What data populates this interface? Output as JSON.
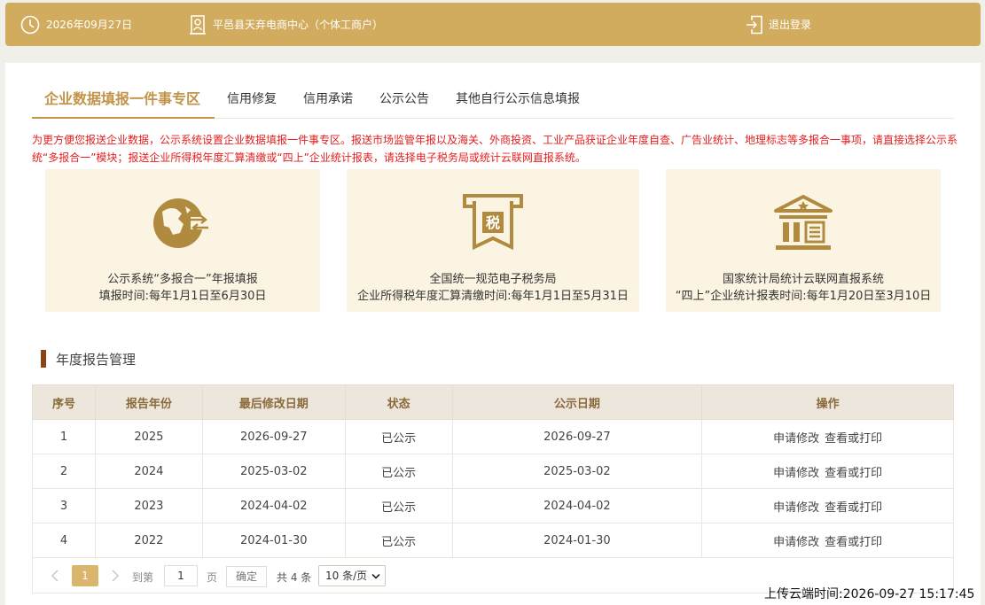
{
  "header": {
    "date": "2026年09月27日",
    "company": "平邑县天弃电商中心（个体工商户）",
    "logout_label": "退出登录"
  },
  "tabs": [
    {
      "label": "企业数据填报一件事专区"
    },
    {
      "label": "信用修复"
    },
    {
      "label": "信用承诺"
    },
    {
      "label": "公示公告"
    },
    {
      "label": "其他自行公示信息填报"
    }
  ],
  "notice": "为更方便您报送企业数据，公示系统设置企业数据填报一件事专区。报送市场监管年报以及海关、外商投资、工业产品获证企业年度自查、广告业统计、地理标志等多报合一事项，请直接选择公示系统“多报合一”模块；报送企业所得税年度汇算清缴或“四上”企业统计报表，请选择电子税务局或统计云联网直报系统。",
  "cards": [
    {
      "icon": "annual-report-icon",
      "line1": "公示系统“多报合一”年报填报",
      "line2": "填报时间:每年1月1日至6月30日"
    },
    {
      "icon": "tax-icon",
      "icon_text": "税",
      "line1": "全国统一规范电子税务局",
      "line2": "企业所得税年度汇算清缴时间:每年1月1日至5月31日"
    },
    {
      "icon": "bank-building-icon",
      "line1": "国家统计局统计云联网直报系统",
      "line2": "“四上”企业统计报表时间:每年1月20日至3月10日"
    }
  ],
  "section_title": "年度报告管理",
  "table": {
    "headers": [
      "序号",
      "报告年份",
      "最后修改日期",
      "状态",
      "公示日期",
      "操作"
    ],
    "rows": [
      {
        "no": "1",
        "year": "2025",
        "modified": "2026-09-27",
        "status": "已公示",
        "published": "2026-09-27"
      },
      {
        "no": "2",
        "year": "2024",
        "modified": "2025-03-02",
        "status": "已公示",
        "published": "2025-03-02"
      },
      {
        "no": "3",
        "year": "2023",
        "modified": "2024-04-02",
        "status": "已公示",
        "published": "2024-04-02"
      },
      {
        "no": "4",
        "year": "2022",
        "modified": "2024-01-30",
        "status": "已公示",
        "published": "2024-01-30"
      }
    ],
    "action_modify": "申请修改",
    "action_view": "查看或打印"
  },
  "pager": {
    "current_page": "1",
    "goto_label": "到第",
    "goto_value": "1",
    "page_unit": "页",
    "confirm_label": "确定",
    "total": "共 4 条",
    "page_size": "10 条/页"
  },
  "upload_time": "上传云端时间:2026-09-27 15:17:45",
  "colors": {
    "header_bg": "#d2ac5e",
    "accent": "#c1944a",
    "notice": "#e51d1d",
    "card_bg": "#fcf4e2",
    "icon": "#b08a3e"
  }
}
